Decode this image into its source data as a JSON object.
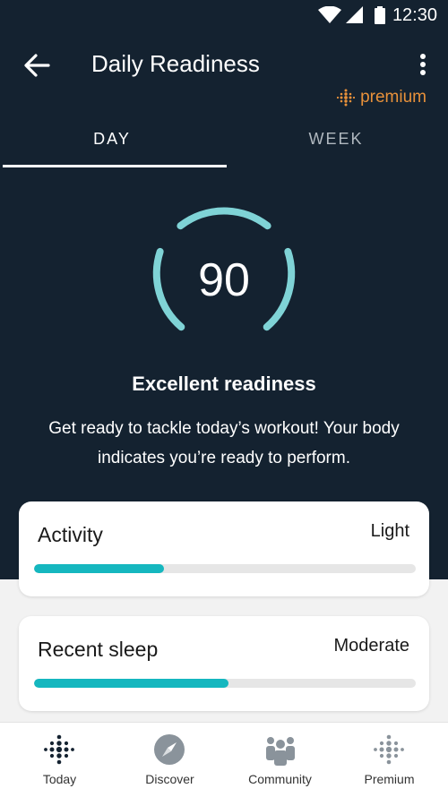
{
  "status_bar": {
    "time": "12:30"
  },
  "header": {
    "title": "Daily Readiness",
    "premium_label": "premium"
  },
  "tabs": [
    {
      "label": "DAY"
    },
    {
      "label": "WEEK"
    }
  ],
  "readiness": {
    "score": "90",
    "headline": "Excellent readiness",
    "description": "Get ready to tackle today’s workout! Your body indicates you’re ready to perform."
  },
  "cards": [
    {
      "label": "Activity",
      "level": "Light",
      "progress": 0.34
    },
    {
      "label": "Recent sleep",
      "level": "Moderate",
      "progress": 0.51
    }
  ],
  "nav": [
    {
      "label": "Today",
      "icon": "fitbit-dots-icon"
    },
    {
      "label": "Discover",
      "icon": "compass-icon"
    },
    {
      "label": "Community",
      "icon": "community-icon"
    },
    {
      "label": "Premium",
      "icon": "fitbit-dots-outline-icon"
    }
  ],
  "colors": {
    "background": "#142230",
    "accent": "#15b7bf",
    "gauge": "#7fd3d6",
    "premium": "#e8913a"
  }
}
